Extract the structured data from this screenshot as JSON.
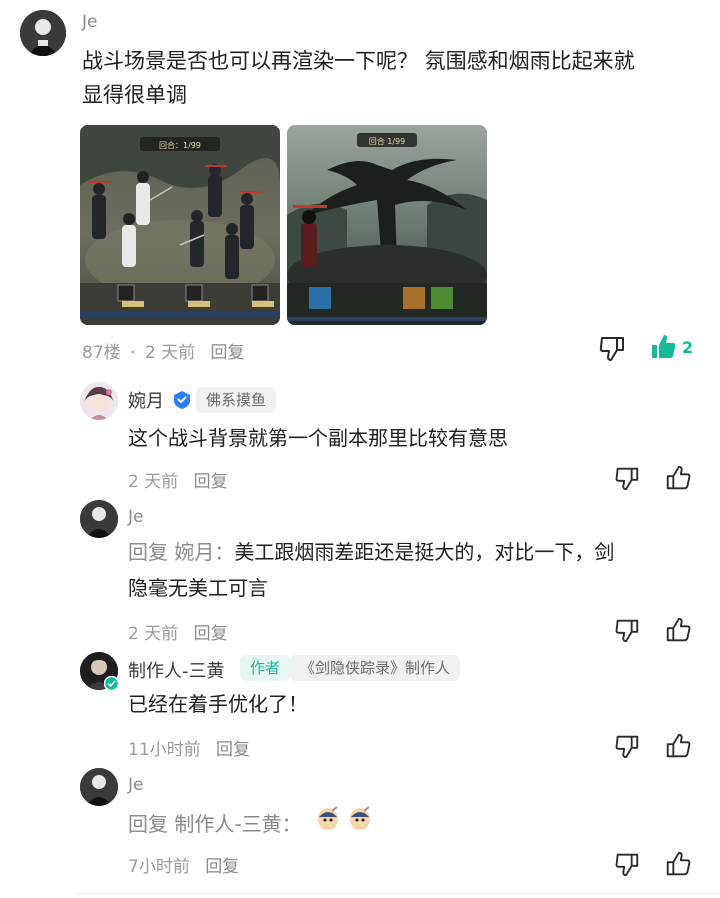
{
  "main_comment": {
    "author": "Je",
    "text_line1": "战斗场景是否也可以再渲染一下呢？ 氛围感和烟雨比起来就",
    "text_line2": "显得很单调",
    "floor": "87楼",
    "sep": "·",
    "time": "2 天前",
    "reply_label": "回复",
    "like_count": "2",
    "image1_hud": "回合：1/99",
    "image2_hud": "回合 1/99"
  },
  "replies": [
    {
      "author": "婉月",
      "tag": "佛系摸鱼",
      "text": "这个战斗背景就第一个副本那里比较有意思",
      "time": "2 天前",
      "reply_label": "回复"
    },
    {
      "author": "Je",
      "reply_prefix": "回复 婉月：",
      "text_line1": "美工跟烟雨差距还是挺大的，对比一下，剑",
      "text_line2": "隐毫无美工可言",
      "time": "2 天前",
      "reply_label": "回复"
    },
    {
      "author": "制作人-三黄",
      "tag_author": "作者",
      "tag_title": "《剑隐侠踪录》制作人",
      "text": "已经在着手优化了！",
      "time": "11小时前",
      "reply_label": "回复"
    },
    {
      "author": "Je",
      "reply_prefix": "回复 制作人-三黄：",
      "time": "7小时前",
      "reply_label": "回复"
    }
  ],
  "colors": {
    "accent": "#14b89a",
    "text": "#1f1f1f",
    "muted": "#9b9b9b"
  }
}
